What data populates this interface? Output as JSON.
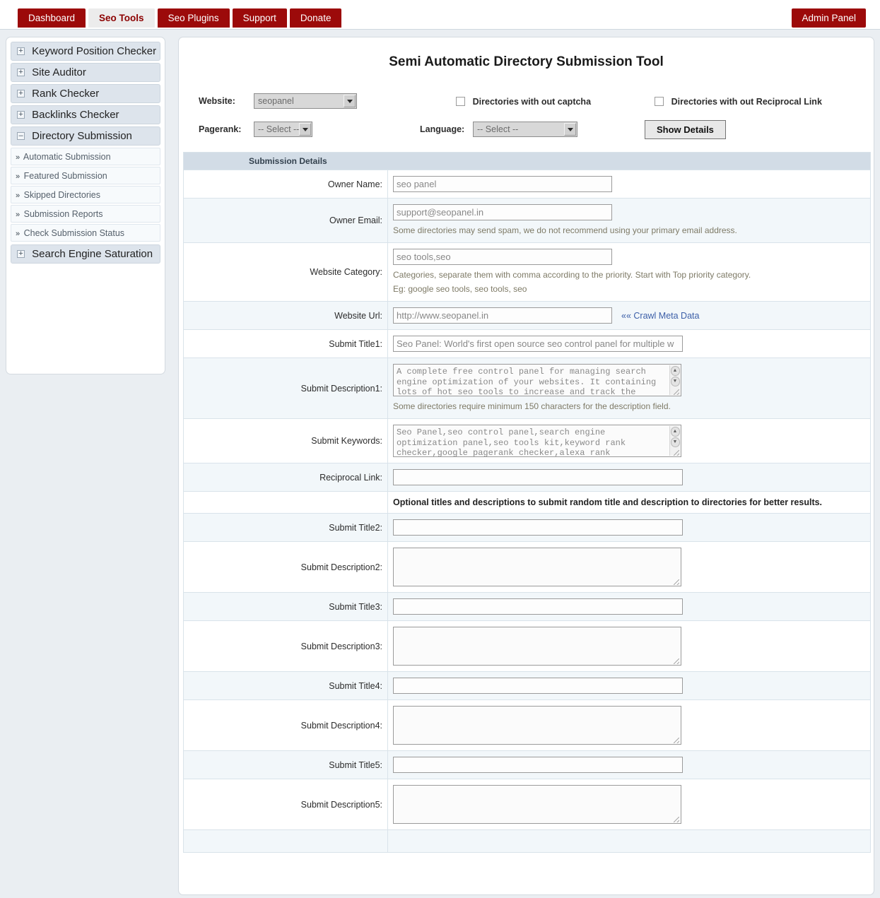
{
  "nav": {
    "tabs": [
      {
        "label": "Dashboard",
        "active": false
      },
      {
        "label": "Seo Tools",
        "active": true
      },
      {
        "label": "Seo Plugins",
        "active": false
      },
      {
        "label": "Support",
        "active": false
      },
      {
        "label": "Donate",
        "active": false
      }
    ],
    "admin_panel_label": "Admin Panel",
    "accent_color": "#9c0a0a",
    "active_tab_text_color": "#8c0000"
  },
  "sidebar": {
    "groups": [
      {
        "toggle": "+",
        "label": "Keyword Position Checker",
        "expanded": false
      },
      {
        "toggle": "+",
        "label": "Site Auditor",
        "expanded": false
      },
      {
        "toggle": "+",
        "label": "Rank Checker",
        "expanded": false
      },
      {
        "toggle": "+",
        "label": "Backlinks Checker",
        "expanded": false
      },
      {
        "toggle": "–",
        "label": "Directory Submission",
        "expanded": true
      }
    ],
    "sub_items": [
      {
        "label": "Automatic Submission"
      },
      {
        "label": "Featured Submission"
      },
      {
        "label": "Skipped Directories"
      },
      {
        "label": "Submission Reports"
      },
      {
        "label": "Check Submission Status"
      }
    ],
    "last_group": {
      "toggle": "+",
      "label": "Search Engine Saturation",
      "expanded": false
    }
  },
  "main": {
    "title": "Semi Automatic Directory Submission Tool",
    "filters": {
      "website_label": "Website:",
      "website_value": "seopanel",
      "pagerank_label": "Pagerank:",
      "pagerank_value": "-- Select --",
      "language_label": "Language:",
      "language_value": "-- Select --",
      "checkbox_captcha_label": "Directories with out captcha",
      "checkbox_captcha_checked": false,
      "checkbox_reciprocal_label": "Directories with out Reciprocal Link",
      "checkbox_reciprocal_checked": false,
      "show_details_label": "Show Details"
    },
    "table": {
      "section_header": "Submission Details",
      "owner_name_label": "Owner Name:",
      "owner_name_value": "seo panel",
      "owner_email_label": "Owner Email:",
      "owner_email_value": "support@seopanel.in",
      "owner_email_hint": "Some directories may send spam, we do not recommend using your primary email address.",
      "website_category_label": "Website Category:",
      "website_category_value": "seo tools,seo",
      "website_category_hint1": "Categories, separate them with comma according to the priority. Start with Top priority category.",
      "website_category_hint2": "Eg: google seo tools, seo tools, seo",
      "website_url_label": "Website Url:",
      "website_url_value": "http://www.seopanel.in",
      "crawl_meta_link": "«« Crawl Meta Data",
      "submit_title1_label": "Submit Title1:",
      "submit_title1_value": "Seo Panel: World's first open source seo control panel for multiple w",
      "submit_description1_label": "Submit Description1:",
      "submit_description1_value": "A complete free control panel for managing search engine optimization of your websites. It containing lots of hot seo tools to increase and track the",
      "submit_description1_hint": "Some directories require minimum 150 characters for the description field.",
      "submit_keywords_label": "Submit Keywords:",
      "submit_keywords_value": "Seo Panel,seo control panel,search engine optimization panel,seo tools kit,keyword rank checker,google pagerank checker,alexa rank checker,sitemap",
      "reciprocal_link_label": "Reciprocal Link:",
      "reciprocal_link_value": "",
      "optional_note": "Optional titles and descriptions to submit random title and description to directories for better results.",
      "optional_pairs": [
        {
          "title_label": "Submit Title2:",
          "title_value": "",
          "desc_label": "Submit Description2:",
          "desc_value": ""
        },
        {
          "title_label": "Submit Title3:",
          "title_value": "",
          "desc_label": "Submit Description3:",
          "desc_value": ""
        },
        {
          "title_label": "Submit Title4:",
          "title_value": "",
          "desc_label": "Submit Description4:",
          "desc_value": ""
        },
        {
          "title_label": "Submit Title5:",
          "title_value": "",
          "desc_label": "Submit Description5:",
          "desc_value": ""
        }
      ]
    }
  },
  "icons": {
    "scroll_up": "▲",
    "scroll_down": "▼",
    "sub_chevron": "»"
  }
}
